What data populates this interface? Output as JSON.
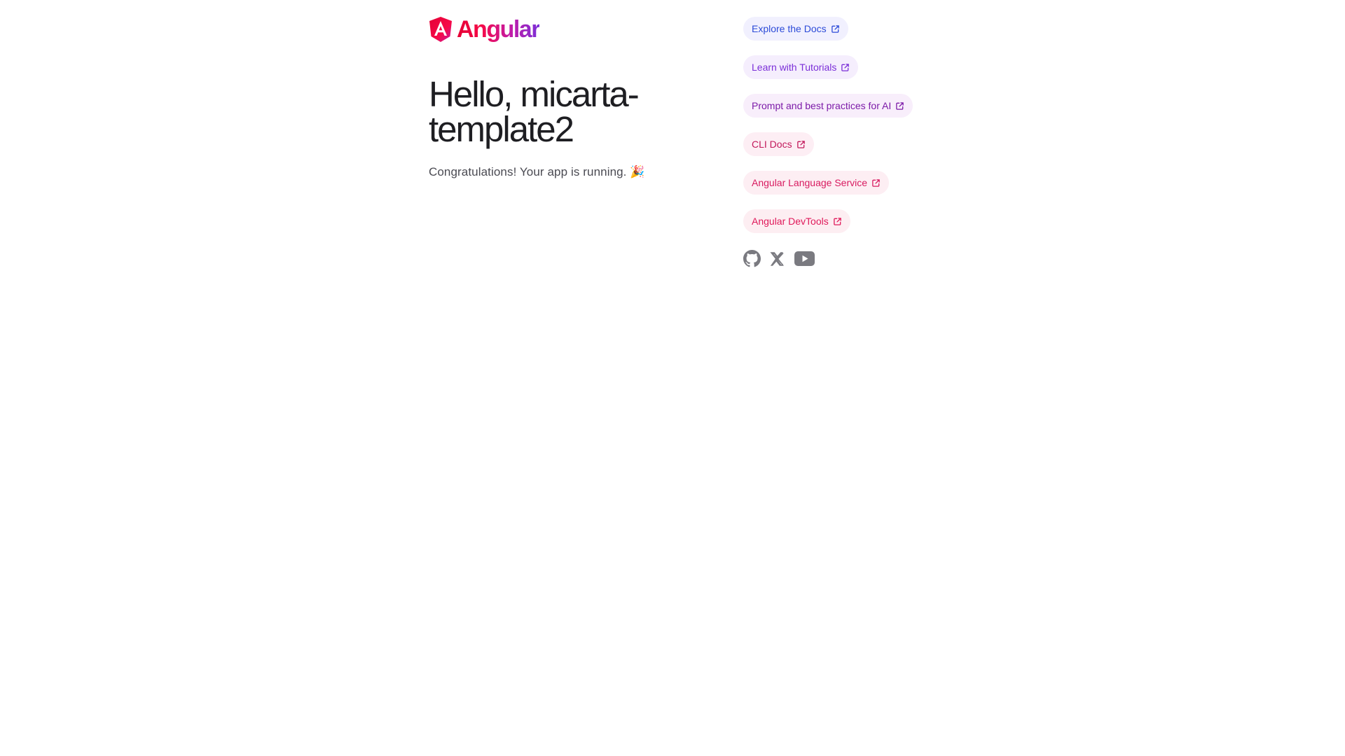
{
  "brand": {
    "logo_text": "Angular"
  },
  "main": {
    "title": "Hello, micarta-template2",
    "subtitle": "Congratulations! Your app is running. 🎉"
  },
  "links": [
    {
      "label": "Explore the Docs",
      "bg": "#f1f0fe",
      "color": "#2c4bd8",
      "icon": "external-link-icon"
    },
    {
      "label": "Learn with Tutorials",
      "bg": "#f5eefd",
      "color": "#7b2fd8",
      "icon": "external-link-icon"
    },
    {
      "label": "Prompt and best practices for AI",
      "bg": "#f8eefb",
      "color": "#7c1aa8",
      "icon": "external-link-icon"
    },
    {
      "label": "CLI Docs",
      "bg": "#fdeef4",
      "color": "#c2185b",
      "icon": "external-link-icon"
    },
    {
      "label": "Angular Language Service",
      "bg": "#fdeef3",
      "color": "#d81b60",
      "icon": "external-link-icon"
    },
    {
      "label": "Angular DevTools",
      "bg": "#fdeef2",
      "color": "#e0195a",
      "icon": "external-link-icon"
    }
  ],
  "socials": [
    {
      "name": "github-icon"
    },
    {
      "name": "x-icon"
    },
    {
      "name": "youtube-icon"
    }
  ],
  "colors": {
    "social_icon": "#7a7a80",
    "title": "#1e1e22"
  }
}
